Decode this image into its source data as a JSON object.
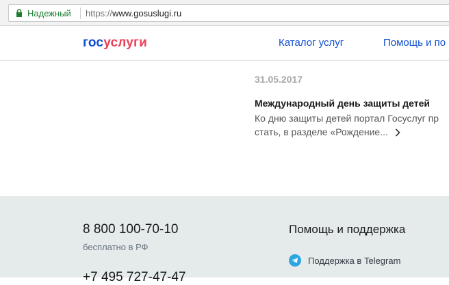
{
  "browser": {
    "secure_label": "Надежный",
    "url_scheme": "https://",
    "url_host": "www.gosuslugi.ru"
  },
  "header": {
    "logo_part1": "гос",
    "logo_part2": "услуги",
    "nav": [
      {
        "label": "Каталог услуг"
      },
      {
        "label": "Помощь и по"
      }
    ]
  },
  "news": {
    "date": "31.05.2017",
    "title": "Международный день защиты детей",
    "text_line1": "Ко дню защиты детей портал Госуслуг пр",
    "text_line2": "стать, в разделе «Рождение..."
  },
  "footer": {
    "phone_main": "8 800 100-70-10",
    "phone_note": "бесплатно в РФ",
    "phone_second": "+7 495 727-47-47",
    "support_heading": "Помощь и поддержка",
    "telegram_label": "Поддержка в Telegram"
  },
  "colors": {
    "brand_blue": "#0d4cd3",
    "brand_red": "#ee3f58",
    "secure_green": "#1e7e34",
    "footer_bg": "#e5ebeb",
    "telegram_blue": "#2ca5e0"
  },
  "icons": {
    "lock": "lock-icon",
    "chevron": "chevron-right-icon",
    "telegram": "telegram-icon"
  }
}
